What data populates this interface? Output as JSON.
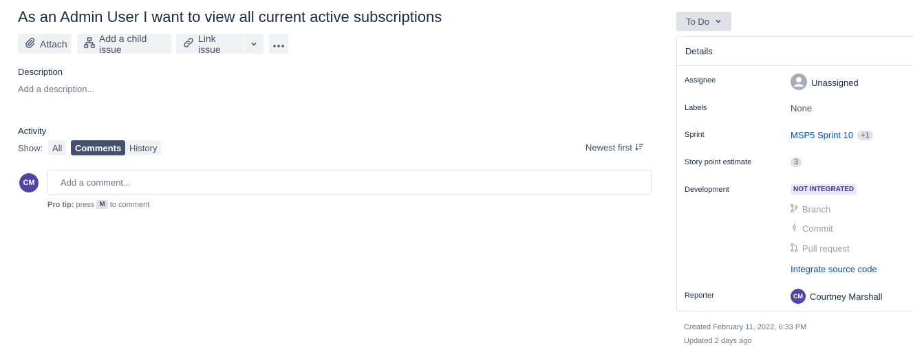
{
  "issue": {
    "title": "As an Admin User I want to view all current active subscriptions"
  },
  "toolbar": {
    "attach": "Attach",
    "add_child": "Add a child issue",
    "link_issue": "Link issue"
  },
  "description": {
    "label": "Description",
    "placeholder": "Add a description..."
  },
  "activity": {
    "label": "Activity",
    "show_label": "Show:",
    "filters": [
      "All",
      "Comments",
      "History"
    ],
    "active_filter": "Comments",
    "sort": "Newest first"
  },
  "comment": {
    "avatar_initials": "CM",
    "placeholder": "Add a comment...",
    "protip_bold": "Pro tip:",
    "protip_press": "press",
    "protip_key": "M",
    "protip_end": "to comment"
  },
  "status": {
    "label": "To Do"
  },
  "details": {
    "header": "Details",
    "assignee_label": "Assignee",
    "assignee_value": "Unassigned",
    "labels_label": "Labels",
    "labels_value": "None",
    "sprint_label": "Sprint",
    "sprint_value": "MSP5 Sprint 10",
    "sprint_extra": "+1",
    "estimate_label": "Story point estimate",
    "estimate_value": "3",
    "development_label": "Development",
    "development_badge": "NOT INTEGRATED",
    "dev_items": [
      "Branch",
      "Commit",
      "Pull request"
    ],
    "integrate_link": "Integrate source code",
    "reporter_label": "Reporter",
    "reporter_initials": "CM",
    "reporter_name": "Courtney Marshall"
  },
  "meta": {
    "created": "Created February 11, 2022, 6:33 PM",
    "updated": "Updated 2 days ago"
  },
  "colors": {
    "avatar": "#5243aa",
    "link": "#0052cc",
    "lozenge_bg": "#eae6ff"
  }
}
